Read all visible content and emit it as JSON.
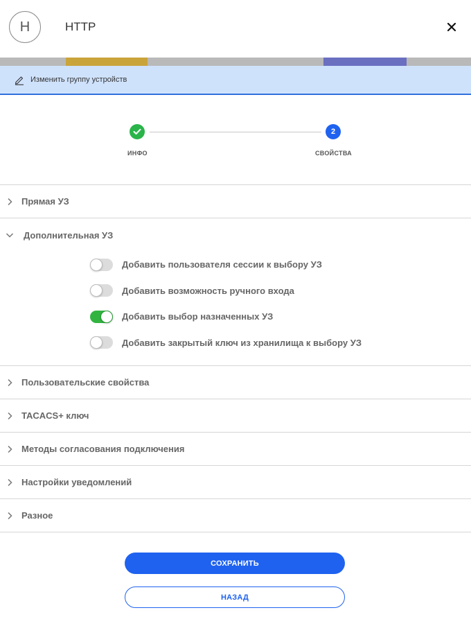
{
  "header": {
    "avatar_letter": "H",
    "title": "HTTP"
  },
  "edit_bar": {
    "label": "Изменить группу устройств"
  },
  "stepper": {
    "steps": [
      {
        "label": "ИНФО",
        "state": "completed"
      },
      {
        "label": "СВОЙСТВА",
        "number": "2",
        "state": "active"
      }
    ]
  },
  "sections": [
    {
      "label": "Прямая УЗ",
      "expanded": false
    },
    {
      "label": "Дополнительная УЗ",
      "expanded": true,
      "toggles": [
        {
          "label": "Добавить пользователя сессии к выбору УЗ",
          "on": false
        },
        {
          "label": "Добавить возможность ручного входа",
          "on": false
        },
        {
          "label": "Добавить выбор назначенных УЗ",
          "on": true
        },
        {
          "label": "Добавить закрытый ключ из хранилища к выбору УЗ",
          "on": false
        }
      ]
    },
    {
      "label": "Пользовательские свойства",
      "expanded": false
    },
    {
      "label": "TACACS+ ключ",
      "expanded": false
    },
    {
      "label": "Методы согласования подключения",
      "expanded": false
    },
    {
      "label": "Настройки уведомлений",
      "expanded": false
    },
    {
      "label": "Разное",
      "expanded": false
    }
  ],
  "buttons": {
    "save": "СОХРАНИТЬ",
    "back": "НАЗАД"
  },
  "colors": {
    "accent": "#1f62f0",
    "success": "#2bb44a",
    "edit_bar_bg": "#cfe2fc"
  }
}
